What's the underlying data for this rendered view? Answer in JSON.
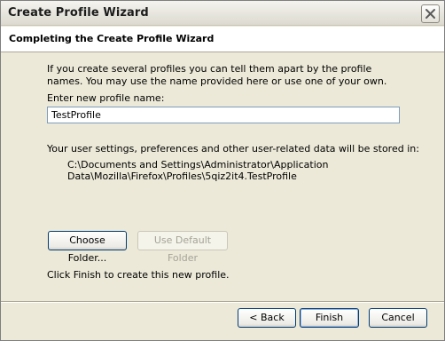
{
  "window": {
    "title": "Create Profile Wizard"
  },
  "header": {
    "title": "Completing the Create Profile Wizard"
  },
  "content": {
    "intro": "If you create several profiles you can tell them apart by the profile names. You may use the name provided here or use one of your own.",
    "name_label": "Enter new profile name:",
    "name_value": "TestProfile",
    "storage_label": "Your user settings, preferences and other user-related data will be stored in:",
    "storage_path": "C:\\Documents and Settings\\Administrator\\Application Data\\Mozilla\\Firefox\\Profiles\\5qiz2it4.TestProfile",
    "choose_folder_label": "Choose Folder...",
    "use_default_folder_label": "Use Default Folder",
    "finish_note": "Click Finish to create this new profile."
  },
  "footer": {
    "back_label": "< Back",
    "finish_label": "Finish",
    "cancel_label": "Cancel"
  },
  "icons": {
    "close": "close-icon"
  }
}
